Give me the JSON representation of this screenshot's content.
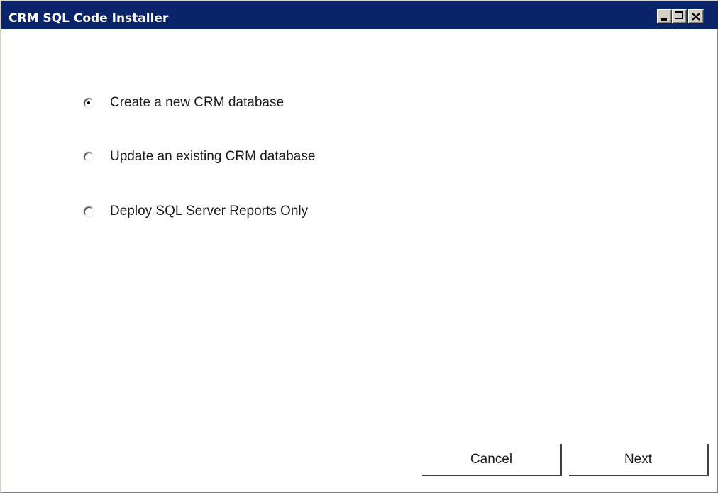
{
  "window": {
    "title": "CRM SQL Code Installer",
    "controls": {
      "minimize": "minimize-icon",
      "maximize": "maximize-icon",
      "close": "close-icon"
    },
    "title_bar_color": "#0a246a"
  },
  "options": [
    {
      "label": "Create a new CRM database",
      "selected": true
    },
    {
      "label": "Update an existing CRM database",
      "selected": false
    },
    {
      "label": "Deploy SQL Server Reports Only",
      "selected": false
    }
  ],
  "buttons": {
    "cancel_label": "Cancel",
    "next_label": "Next"
  }
}
